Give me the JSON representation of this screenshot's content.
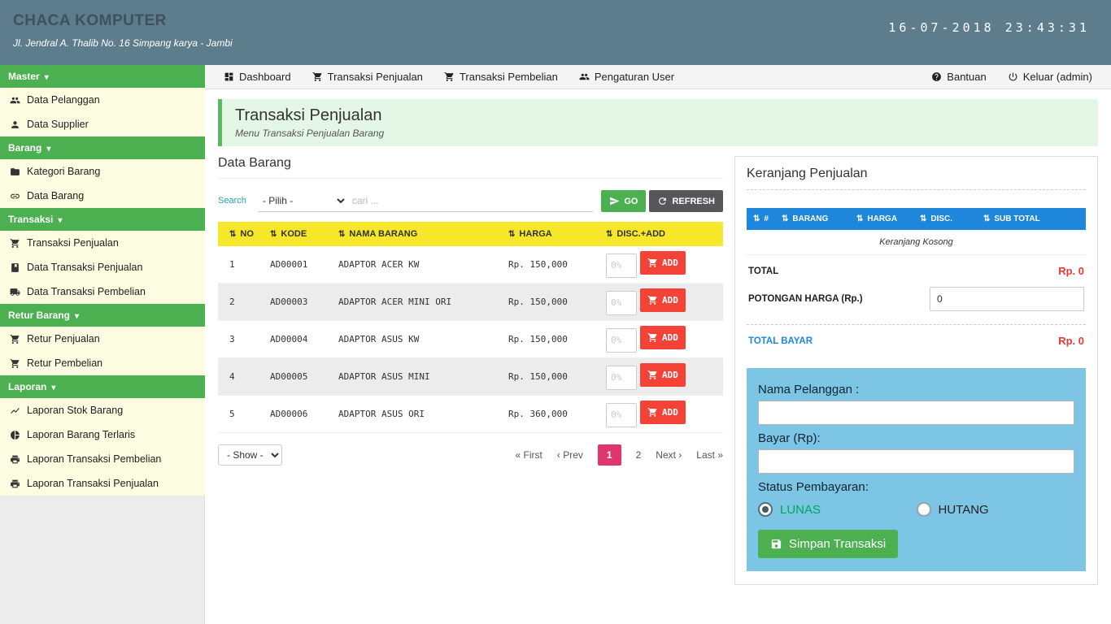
{
  "topbar": {
    "brand": "CHACA KOMPUTER",
    "address": "Jl. Jendral A. Thalib No. 16 Simpang karya - Jambi",
    "datetime": "16-07-2018 23:43:31"
  },
  "navbar": {
    "items": [
      "Dashboard",
      "Transaksi Penjualan",
      "Transaksi Pembelian",
      "Pengaturan User"
    ],
    "bantuan": "Bantuan",
    "keluar": "Keluar (admin)"
  },
  "sidebar": {
    "sections": [
      {
        "label": "Master",
        "items": [
          "Data Pelanggan",
          "Data Supplier"
        ]
      },
      {
        "label": "Barang",
        "items": [
          "Kategori Barang",
          "Data Barang"
        ]
      },
      {
        "label": "Transaksi",
        "items": [
          "Transaksi Penjualan",
          "Data Transaksi Penjualan",
          "Data Transaksi Pembelian"
        ]
      },
      {
        "label": "Retur Barang",
        "items": [
          "Retur Penjualan",
          "Retur Pembelian"
        ]
      },
      {
        "label": "Laporan",
        "items": [
          "Laporan Stok Barang",
          "Laporan Barang Terlaris",
          "Laporan Transaksi Pembelian",
          "Laporan Transaksi Penjualan"
        ]
      }
    ]
  },
  "page": {
    "title": "Transaksi Penjualan",
    "subtitle": "Menu Transaksi Penjualan Barang"
  },
  "barang": {
    "title": "Data Barang",
    "search_label": "Search",
    "filter_option": "- Pilih -",
    "search_placeholder": "cari ...",
    "go": "GO",
    "refresh": "REFRESH",
    "headers": [
      "NO",
      "KODE",
      "NAMA BARANG",
      "HARGA",
      "DISC.+ADD"
    ],
    "disc_placeholder": "0%",
    "add": "ADD",
    "rows": [
      {
        "no": "1",
        "kode": "AD00001",
        "nama": "ADAPTOR ACER KW",
        "harga": "Rp. 150,000"
      },
      {
        "no": "2",
        "kode": "AD00003",
        "nama": "ADAPTOR ACER MINI ORI",
        "harga": "Rp. 150,000"
      },
      {
        "no": "3",
        "kode": "AD00004",
        "nama": "ADAPTOR ASUS KW",
        "harga": "Rp. 150,000"
      },
      {
        "no": "4",
        "kode": "AD00005",
        "nama": "ADAPTOR ASUS MINI",
        "harga": "Rp. 150,000"
      },
      {
        "no": "5",
        "kode": "AD00006",
        "nama": "ADAPTOR ASUS ORI",
        "harga": "Rp. 360,000"
      }
    ],
    "show_option": "- Show -",
    "pagination": {
      "first": "« First",
      "prev": "‹ Prev",
      "page1": "1",
      "page2": "2",
      "next": "Next ›",
      "last": "Last »",
      "active_page": "1"
    }
  },
  "cart": {
    "title": "Keranjang Penjualan",
    "headers": [
      "#",
      "BARANG",
      "HARGA",
      "DISC.",
      "SUB TOTAL"
    ],
    "empty": "Keranjang Kosong",
    "total_label": "TOTAL",
    "total_value": "Rp. 0",
    "potongan_label": "POTONGAN HARGA (Rp.)",
    "potongan_value": "0",
    "total_bayar_label": "TOTAL BAYAR",
    "total_bayar_value": "Rp. 0",
    "form": {
      "nama_label": "Nama Pelanggan :",
      "bayar_label": "Bayar (Rp):",
      "status_label": "Status Pembayaran:",
      "lunas": "LUNAS",
      "hutang": "HUTANG",
      "lunas_selected": true,
      "save": "Simpan Transaksi"
    }
  },
  "colors": {
    "topbar": "#5d7d8d",
    "sidebar_green": "#4caf50",
    "table_header_yellow": "#f7e72a",
    "cart_header_blue": "#1e87db",
    "add_button_red": "#f44336",
    "active_page_pink": "#e0366e",
    "payment_box_blue": "#7cc5e5",
    "money_red": "#e53935",
    "lunas_green": "#00a65a"
  },
  "icons": [
    "dashboard-icon",
    "cart-icon",
    "users-icon",
    "user-icon",
    "help-icon",
    "power-icon",
    "folder-icon",
    "chain-icon",
    "book-icon",
    "truck-icon",
    "chart-line-icon",
    "pie-chart-icon",
    "printer-icon",
    "send-icon",
    "refresh-icon",
    "save-icon",
    "sort-icon",
    "caret-down-icon"
  ]
}
